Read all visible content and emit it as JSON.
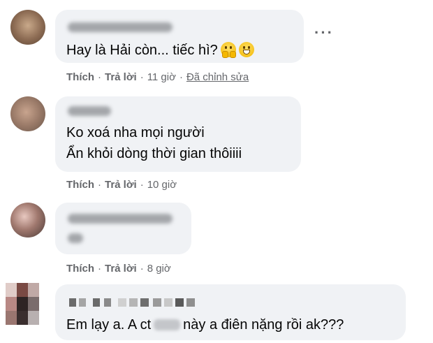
{
  "comments": [
    {
      "text_lines": [
        "Hay là Hải còn... tiếc hì?"
      ],
      "emojis": [
        "face-with-hand-over-mouth",
        "grinning-face"
      ],
      "actions": {
        "like": "Thích",
        "reply": "Trả lời",
        "time": "11 giờ",
        "edited": "Đã chỉnh sửa"
      }
    },
    {
      "text_lines": [
        "Ko xoá nha mọi người",
        "Ẩn khỏi dòng thời gian thôiiii"
      ],
      "actions": {
        "like": "Thích",
        "reply": "Trả lời",
        "time": "10 giờ"
      }
    },
    {
      "text_lines": [],
      "actions": {
        "like": "Thích",
        "reply": "Trả lời",
        "time": "8 giờ"
      }
    },
    {
      "text_lines": [
        "Em lạy a. A ct",
        "này a điên nặng rồi ak???"
      ]
    }
  ],
  "separator": "·",
  "more_icon": "···",
  "colors": {
    "bubble": "#f0f2f5",
    "meta": "#65676b",
    "text": "#050505"
  }
}
